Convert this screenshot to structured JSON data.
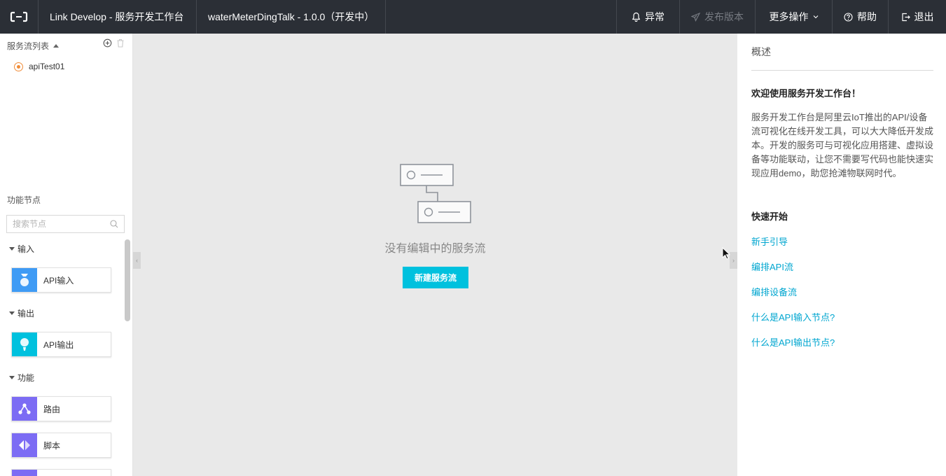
{
  "topbar": {
    "product": "Link Develop - 服务开发工作台",
    "project": "waterMeterDingTalk - 1.0.0（开发中）",
    "alerts": "异常",
    "publish": "发布版本",
    "more": "更多操作",
    "help": "帮助",
    "logout": "退出"
  },
  "sidebar": {
    "flow_list_title": "服务流列表",
    "flows": [
      {
        "name": "apiTest01"
      }
    ],
    "function_title": "功能节点",
    "search_placeholder": "搜索节点",
    "groups": [
      {
        "label": "输入",
        "nodes": [
          {
            "label": "API输入",
            "icon": "api-input-icon",
            "color": "#3f9bf5"
          }
        ]
      },
      {
        "label": "输出",
        "nodes": [
          {
            "label": "API输出",
            "icon": "api-output-icon",
            "color": "#00c1de"
          }
        ]
      },
      {
        "label": "功能",
        "nodes": [
          {
            "label": "路由",
            "icon": "route-icon",
            "color": "#7c6cf4"
          },
          {
            "label": "脚本",
            "icon": "script-icon",
            "color": "#7c6cf4"
          }
        ]
      }
    ]
  },
  "canvas": {
    "empty_text": "没有编辑中的服务流",
    "new_flow_button": "新建服务流"
  },
  "panel": {
    "title": "概述",
    "welcome": "欢迎使用服务开发工作台！",
    "description": "服务开发工作台是阿里云IoT推出的API/设备流可视化在线开发工具，可以大大降低开发成本。开发的服务可与可视化应用搭建、虚拟设备等功能联动，让您不需要写代码也能快速实现应用demo，助您抢滩物联网时代。",
    "quick_start": "快速开始",
    "links": [
      "新手引导",
      "编排API流",
      "编排设备流",
      "什么是API输入节点?",
      "什么是API输出节点?"
    ]
  },
  "colors": {
    "topbar_bg": "#2b2f36",
    "accent": "#00c1de",
    "link": "#00a6d0",
    "canvas_bg": "#e9e9e9"
  }
}
